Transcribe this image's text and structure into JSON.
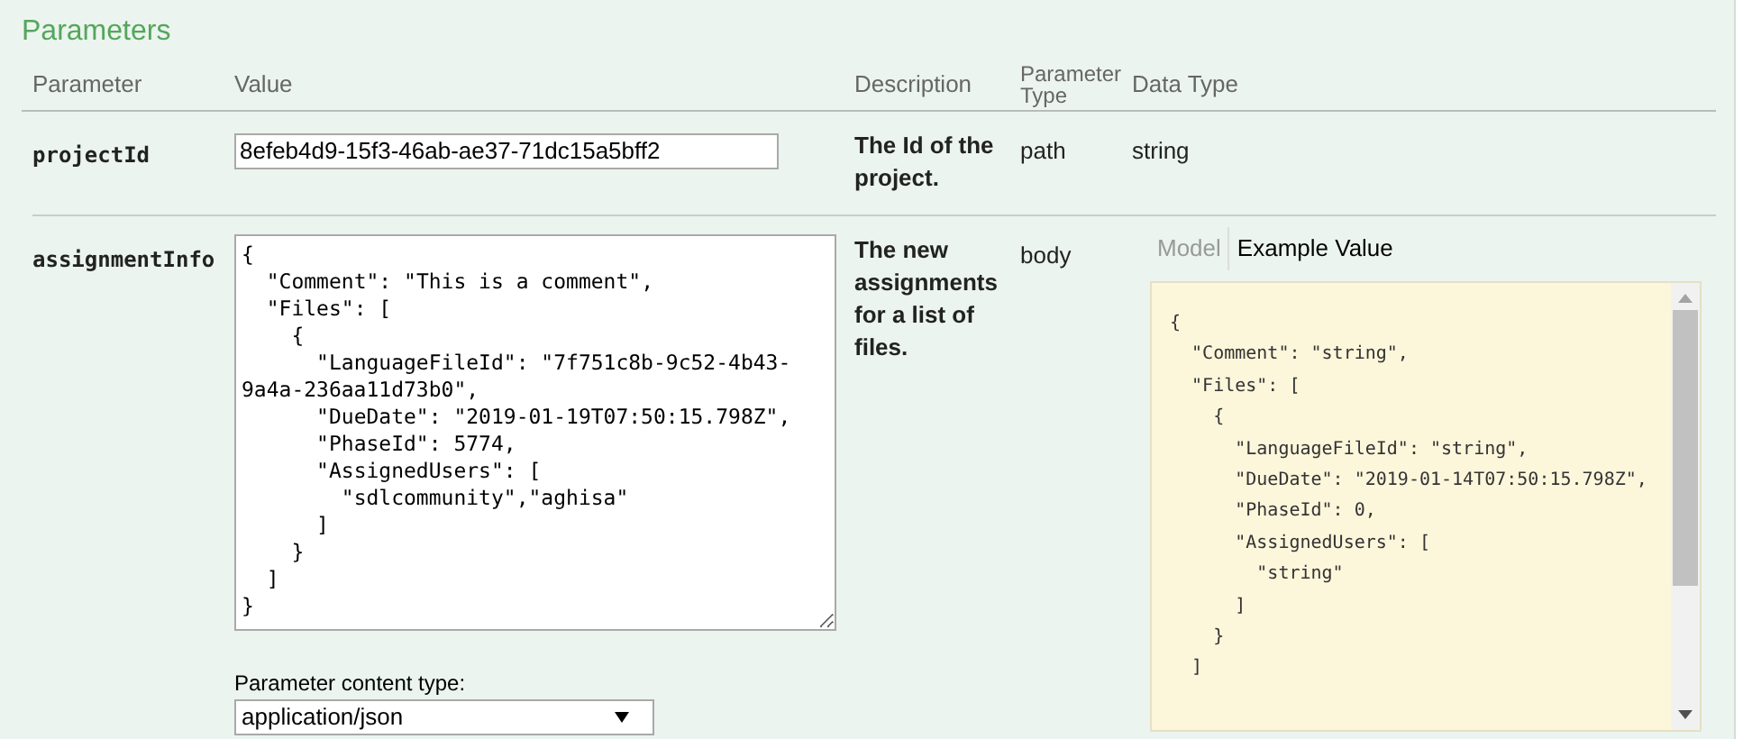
{
  "title": "Parameters",
  "columns": [
    "Parameter",
    "Value",
    "Description",
    "Parameter Type",
    "Data Type"
  ],
  "rows": [
    {
      "kind": "input",
      "name": "projectId",
      "value": "8efeb4d9-15f3-46ab-ae37-71dc15a5bff2",
      "description": "The Id of the project.",
      "parameter_type": "path",
      "data_type": "string"
    },
    {
      "kind": "body",
      "name": "assignmentInfo",
      "value": "{\n  \"Comment\": \"This is a comment\",\n  \"Files\": [\n    {\n      \"LanguageFileId\": \"7f751c8b-9c52-4b43-9a4a-236aa11d73b0\",\n      \"DueDate\": \"2019-01-19T07:50:15.798Z\",\n      \"PhaseId\": 5774,\n      \"AssignedUsers\": [\n        \"sdlcommunity\",\"aghisa\"\n      ]\n    }\n  ]\n}",
      "description": "The new assignments for a list of files.",
      "parameter_type": "body",
      "model_tabs": [
        {
          "label": "Model",
          "selected": false
        },
        {
          "label": "Example Value",
          "selected": true
        }
      ],
      "example_lines": [
        "{",
        "  \"Comment\": \"string\",",
        "  \"Files\": [",
        "    {",
        "      \"LanguageFileId\": \"string\",",
        "      \"DueDate\": \"2019-01-14T07:50:15.798Z\",",
        "      \"PhaseId\": 0,",
        "      \"AssignedUsers\": [",
        "        \"string\"",
        "      ]",
        "    }",
        "  ]"
      ],
      "content_type_label": "Parameter content type:",
      "content_type": "application/json"
    }
  ]
}
